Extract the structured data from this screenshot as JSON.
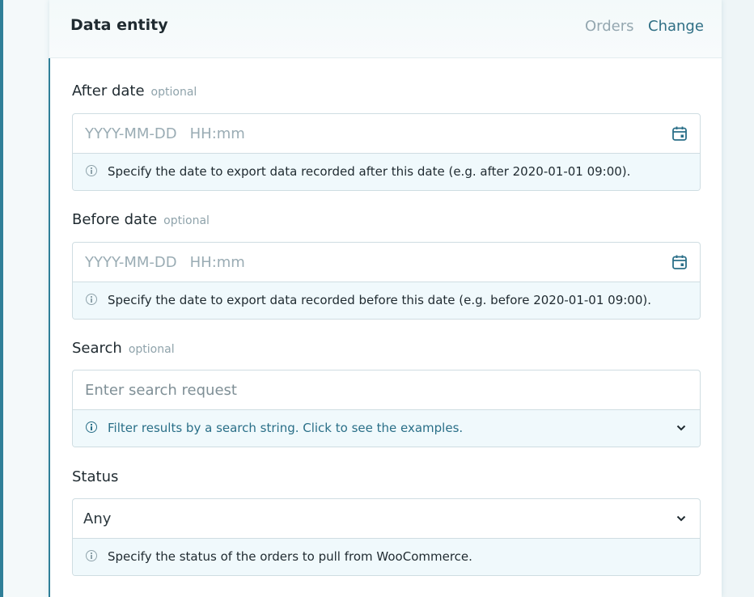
{
  "header": {
    "title": "Data entity",
    "value": "Orders",
    "change_label": "Change"
  },
  "after_date": {
    "label": "After date",
    "optional": "optional",
    "placeholder_date": "YYYY-MM-DD",
    "placeholder_time": "HH:mm",
    "help": "Specify the date to export data recorded after this date (e.g. after 2020-01-01 09:00)."
  },
  "before_date": {
    "label": "Before date",
    "optional": "optional",
    "placeholder_date": "YYYY-MM-DD",
    "placeholder_time": "HH:mm",
    "help": "Specify the date to export data recorded before this date (e.g. before 2020-01-01 09:00)."
  },
  "search": {
    "label": "Search",
    "optional": "optional",
    "placeholder": "Enter search request",
    "help": "Filter results by a search string. Click to see the examples."
  },
  "status": {
    "label": "Status",
    "value": "Any",
    "help": "Specify the status of the orders to pull from WooCommerce."
  },
  "colors": {
    "accent": "#2f7f98",
    "link": "#2a6f88",
    "help_bg": "#f0f9fc"
  },
  "icons": [
    "calendar-icon",
    "info-icon",
    "chevron-down-icon"
  ]
}
